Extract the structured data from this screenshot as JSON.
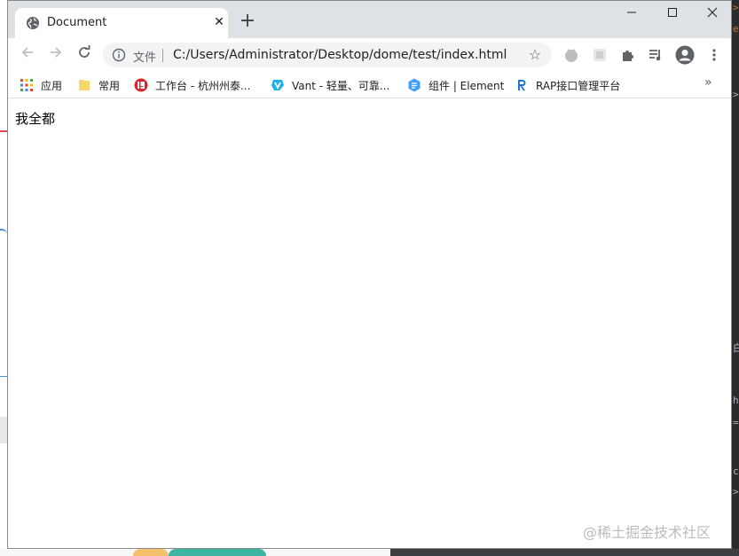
{
  "tab": {
    "title": "Document",
    "close_glyph": "✕",
    "new_tab_glyph": "+"
  },
  "window_controls": {
    "minimize": "—",
    "maximize": "☐",
    "close": "✕"
  },
  "omnibox": {
    "scheme_label": "文件",
    "url": "C:/Users/Administrator/Desktop/dome/test/index.html"
  },
  "bookmarks": [
    {
      "label": "应用",
      "icon": "apps-grid-icon"
    },
    {
      "label": "常用",
      "icon": "folder-icon"
    },
    {
      "label": "工作台 - 杭州州泰...",
      "icon": "red-logo-icon"
    },
    {
      "label": "Vant - 轻量、可靠...",
      "icon": "vant-icon"
    },
    {
      "label": "组件 | Element",
      "icon": "element-icon"
    },
    {
      "label": "RAP接口管理平台",
      "icon": "rap-icon"
    }
  ],
  "bookmarks_more": "»",
  "page": {
    "text": "我全都"
  },
  "watermark": "@稀土掘金技术社区",
  "colors": {
    "titlebar": "#dee1e6",
    "tab": "#ffffff",
    "omnibox": "#f1f3f4",
    "accent_red": "#e0464e",
    "accent_blue": "#1a73e8"
  }
}
